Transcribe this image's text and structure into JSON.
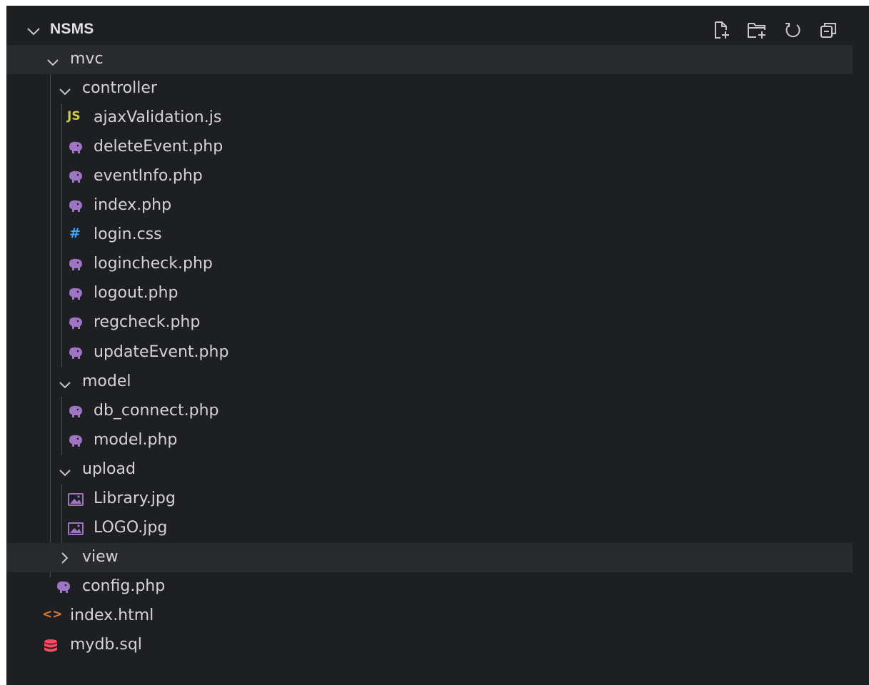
{
  "explorer": {
    "root": "NSMS",
    "actions": [
      {
        "name": "new-file-icon"
      },
      {
        "name": "new-folder-icon"
      },
      {
        "name": "refresh-icon"
      },
      {
        "name": "collapse-all-icon"
      }
    ],
    "tree": {
      "mvc": "mvc",
      "controller": "controller",
      "controller_files": [
        "ajaxValidation.js",
        "deleteEvent.php",
        "eventInfo.php",
        "index.php",
        "login.css",
        "logincheck.php",
        "logout.php",
        "regcheck.php",
        "updateEvent.php"
      ],
      "model": "model",
      "model_files": [
        "db_connect.php",
        "model.php"
      ],
      "upload": "upload",
      "upload_files": [
        "Library.jpg",
        "LOGO.jpg"
      ],
      "view": "view",
      "config": "config.php",
      "root_files": [
        "index.html",
        "mydb.sql"
      ]
    },
    "icon_text": {
      "js": "JS",
      "css": "#",
      "html": "<>"
    },
    "colors": {
      "background": "#1e1f22",
      "row_highlight": "#282a2e",
      "php": "#a074c4",
      "js": "#cbcb41",
      "css": "#42a5f5",
      "html": "#e37933",
      "sql": "#ff4a5e",
      "image": "#a074c4"
    }
  }
}
